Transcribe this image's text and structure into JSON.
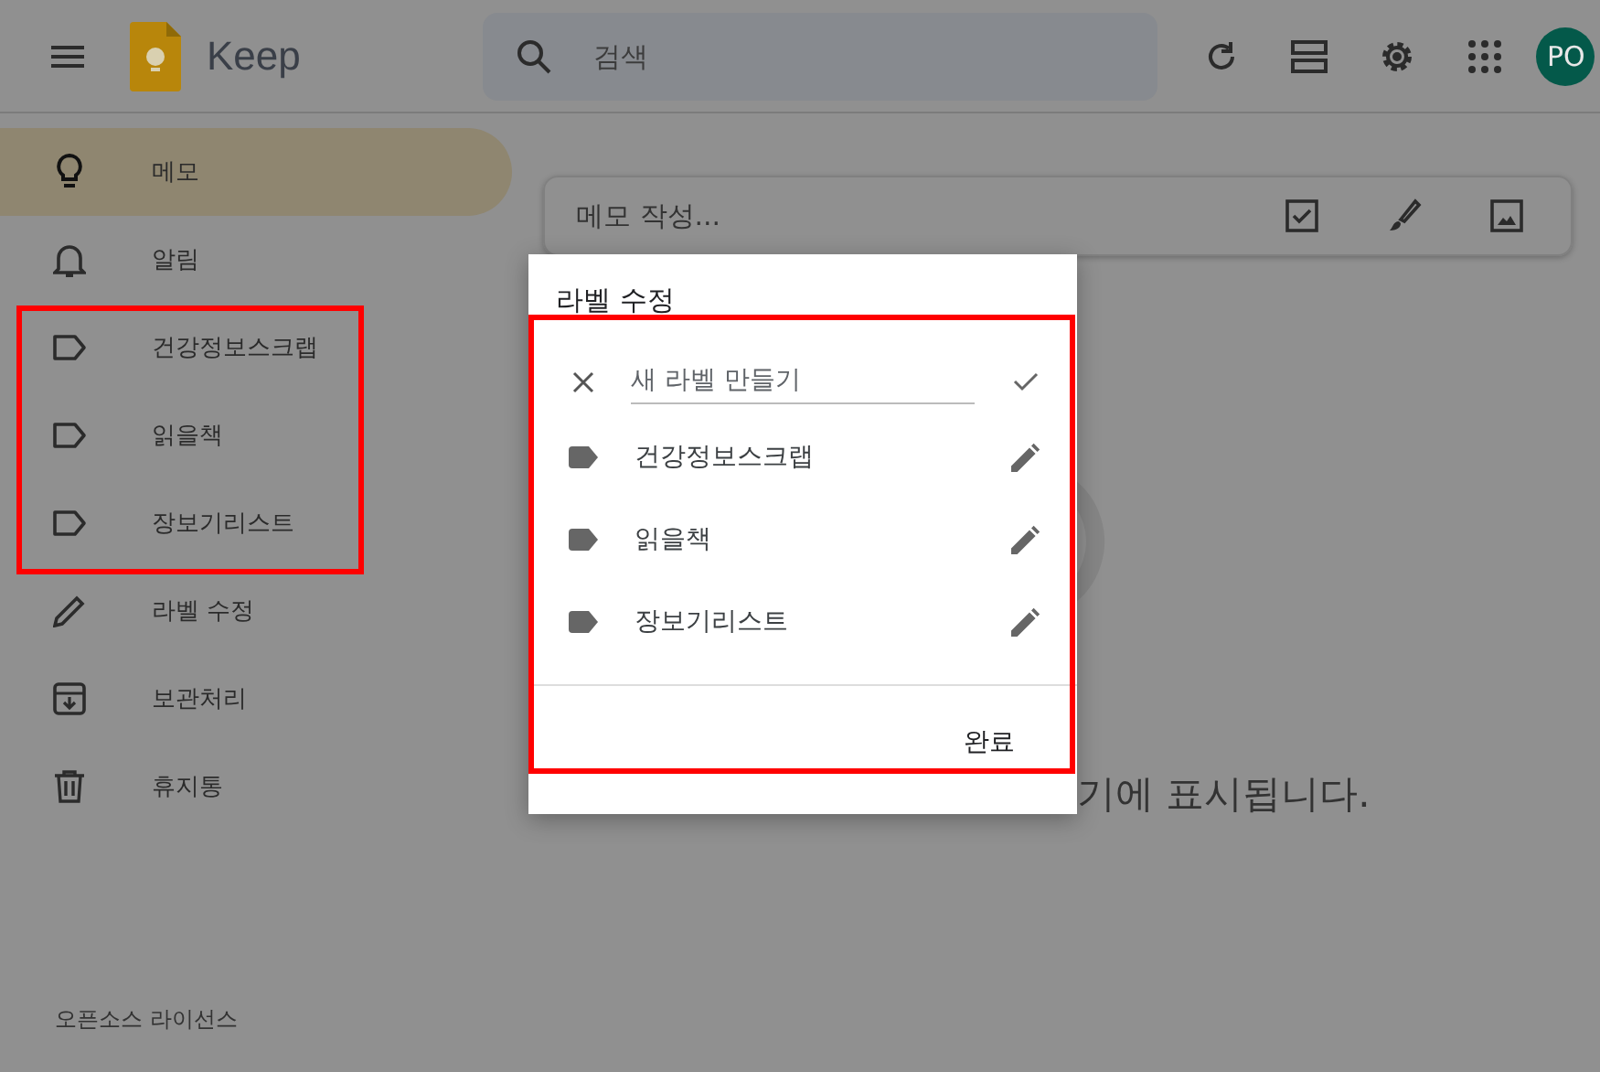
{
  "header": {
    "app_name": "Keep",
    "search": {
      "placeholder": "검색"
    },
    "avatar": "PO"
  },
  "sidebar": {
    "items": [
      {
        "kind": "notes",
        "label": "메모",
        "selected": true
      },
      {
        "kind": "reminders",
        "label": "알림",
        "selected": false
      },
      {
        "kind": "label",
        "label": "건강정보스크랩",
        "selected": false
      },
      {
        "kind": "label",
        "label": "읽을책",
        "selected": false
      },
      {
        "kind": "label",
        "label": "장보기리스트",
        "selected": false
      },
      {
        "kind": "edit-labels",
        "label": "라벨 수정",
        "selected": false
      },
      {
        "kind": "archive",
        "label": "보관처리",
        "selected": false
      },
      {
        "kind": "trash",
        "label": "휴지통",
        "selected": false
      }
    ],
    "footer_link": "오픈소스 라이선스"
  },
  "note_input": {
    "placeholder": "메모 작성..."
  },
  "empty_state": {
    "text": "기에 표시됩니다."
  },
  "dialog": {
    "title": "라벨 수정",
    "new_label": {
      "placeholder": "새 라벨 만들기"
    },
    "labels": [
      "건강정보스크랩",
      "읽을책",
      "장보기리스트"
    ],
    "done_button": "완료"
  }
}
